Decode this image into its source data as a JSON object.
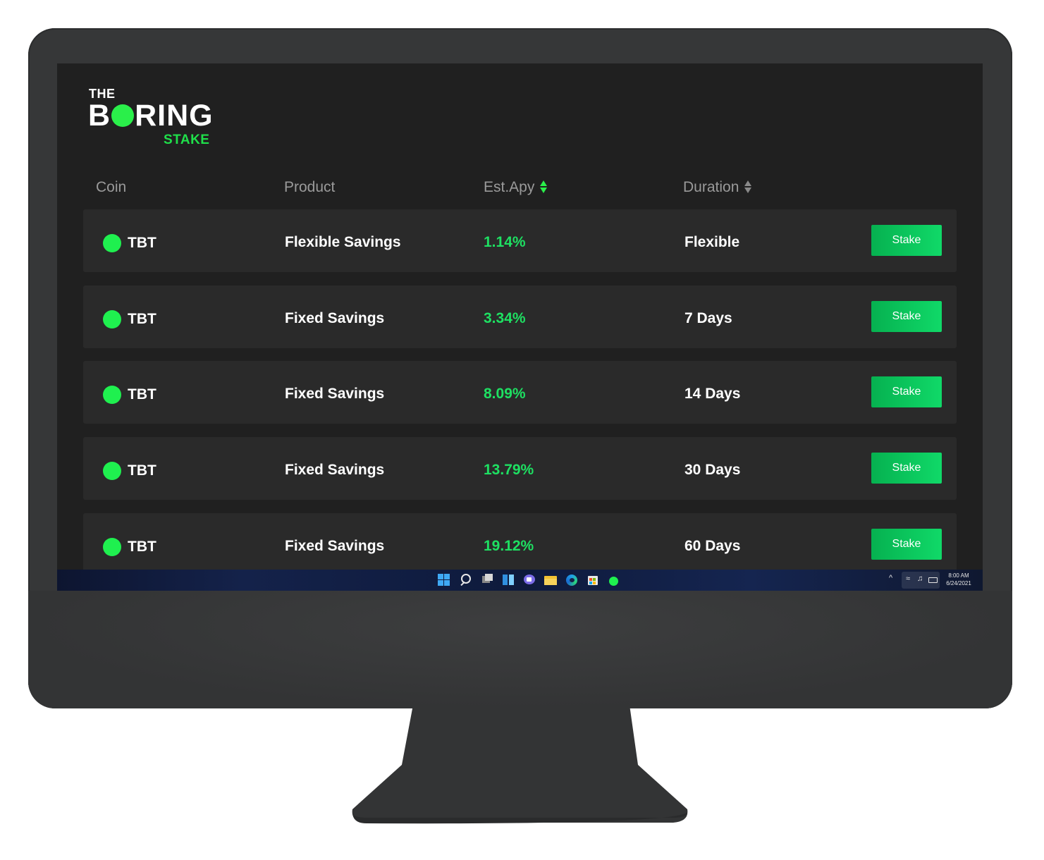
{
  "app": {
    "logo_the": "THE",
    "logo_b": "B",
    "logo_ring": "RING",
    "logo_stake": "STAKE"
  },
  "table": {
    "headers": {
      "coin": "Coin",
      "product": "Product",
      "apy": "Est.Apy",
      "duration": "Duration"
    },
    "rows": [
      {
        "coin": "TBT",
        "product": "Flexible Savings",
        "apy": "1.14%",
        "duration": "Flexible",
        "action": "Stake"
      },
      {
        "coin": "TBT",
        "product": "Fixed Savings",
        "apy": "3.34%",
        "duration": "7 Days",
        "action": "Stake"
      },
      {
        "coin": "TBT",
        "product": "Fixed Savings",
        "apy": "8.09%",
        "duration": "14 Days",
        "action": "Stake"
      },
      {
        "coin": "TBT",
        "product": "Fixed Savings",
        "apy": "13.79%",
        "duration": "30 Days",
        "action": "Stake"
      },
      {
        "coin": "TBT",
        "product": "Fixed Savings",
        "apy": "19.12%",
        "duration": "60 Days",
        "action": "Stake"
      }
    ]
  },
  "taskbar": {
    "icons": [
      "start-icon",
      "search-icon",
      "task-view-icon",
      "widgets-icon",
      "chat-icon",
      "file-explorer-icon",
      "edge-icon",
      "store-icon",
      "boring-stake-app-icon"
    ],
    "tray": {
      "chevron": "^",
      "time": "8:00 AM",
      "date": "6/24/2021"
    }
  },
  "colors": {
    "background": "#202020",
    "row": "#2a2a2a",
    "accent": "#1ff04f",
    "apy_text": "#1ee062",
    "button": "#10d968"
  }
}
